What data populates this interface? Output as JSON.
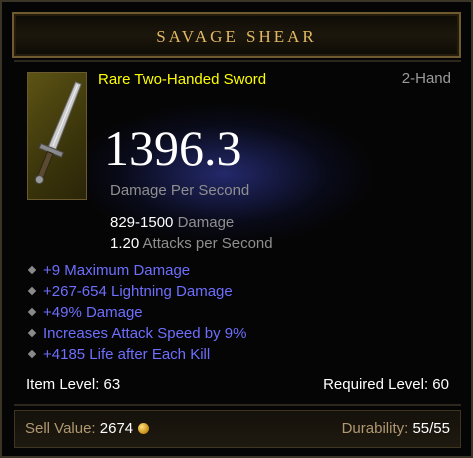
{
  "item": {
    "name": "SAVAGE SHEAR",
    "type": "Rare Two-Handed Sword",
    "slot": "2-Hand",
    "dps_value": "1396.3",
    "dps_label": "Damage Per Second",
    "damage_range": "829-1500",
    "damage_label": "Damage",
    "attack_speed": "1.20",
    "attack_speed_label": "Attacks per Second"
  },
  "affixes": [
    "+9 Maximum Damage",
    "+267-654 Lightning Damage",
    "+49% Damage",
    "Increases Attack Speed by 9%",
    "+4185 Life after Each Kill"
  ],
  "requirements": {
    "item_level": "Item Level: 63",
    "required_level": "Required Level: 60"
  },
  "footer": {
    "sell_label": "Sell Value:",
    "sell_value": "2674",
    "durability_label": "Durability:",
    "durability_value": "55/55"
  },
  "icons": {
    "item": "sword-icon",
    "currency": "gold-coin-icon",
    "bullet": "diamond-bullet-icon"
  },
  "colors": {
    "title": "#e3b863",
    "rare": "#ffff00",
    "magic_affix": "#6e6eff",
    "muted": "#8f8f8f",
    "dps": "#ffffff"
  }
}
